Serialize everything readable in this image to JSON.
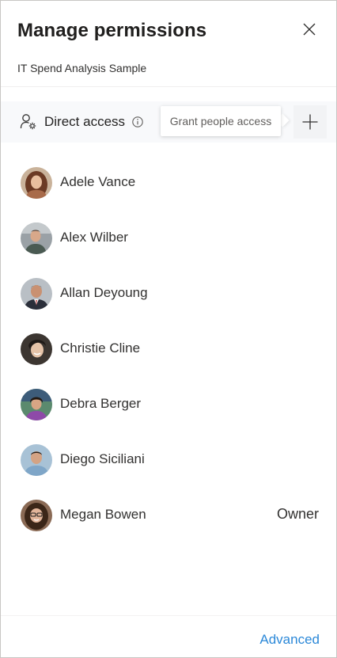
{
  "header": {
    "title": "Manage permissions",
    "subtitle": "IT Spend Analysis Sample",
    "close_icon": "close-icon"
  },
  "toolbar": {
    "direct_access_label": "Direct access",
    "people_settings_icon": "people-settings-icon",
    "info_icon": "info-icon",
    "tooltip": "Grant people access",
    "add_icon": "plus-icon"
  },
  "people": [
    {
      "name": "Adele Vance",
      "role": ""
    },
    {
      "name": "Alex Wilber",
      "role": ""
    },
    {
      "name": "Allan Deyoung",
      "role": ""
    },
    {
      "name": "Christie Cline",
      "role": ""
    },
    {
      "name": "Debra Berger",
      "role": ""
    },
    {
      "name": "Diego Siciliani",
      "role": ""
    },
    {
      "name": "Megan Bowen",
      "role": "Owner"
    }
  ],
  "footer": {
    "advanced_label": "Advanced"
  },
  "colors": {
    "link": "#2b88d8",
    "toolbar_bg": "#f8f9fb",
    "border": "#c8c6c4"
  }
}
